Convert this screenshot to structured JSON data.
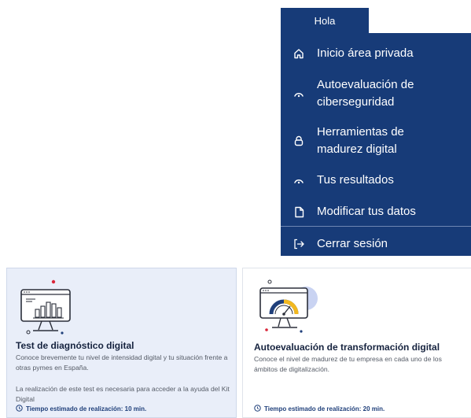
{
  "menu": {
    "greeting": "Hola",
    "items": [
      {
        "label": "Inicio área privada",
        "icon": "home-icon"
      },
      {
        "label": "Autoevaluación de ciberseguridad",
        "icon": "gauge-icon"
      },
      {
        "label": "Herramientas de madurez digital",
        "icon": "lock-icon"
      },
      {
        "label": "Tus resultados",
        "icon": "gauge-icon"
      },
      {
        "label": "Modificar tus datos",
        "icon": "document-icon"
      }
    ],
    "logout": {
      "label": "Cerrar sesión",
      "icon": "logout-icon"
    }
  },
  "cards": [
    {
      "title": "Test de diagnóstico digital",
      "description": "Conoce brevemente tu nivel de intensidad digital y tu situación frente a otras pymes en España.",
      "note": "La realización de este test es necesaria para acceder a la ayuda del Kit Digital",
      "time": "Tiempo estimado de realización: 10 min."
    },
    {
      "title": "Autoevaluación de transformación digital",
      "description": "Conoce el nivel de madurez de tu empresa en cada uno de los ámbitos de digitalización.",
      "time": "Tiempo estimado de realización: 20 min."
    }
  ],
  "colors": {
    "menu_bg": "#173b78",
    "card_highlight_bg": "#e9eef9",
    "accent_red": "#d9263a",
    "accent_yellow": "#f2b81f"
  }
}
